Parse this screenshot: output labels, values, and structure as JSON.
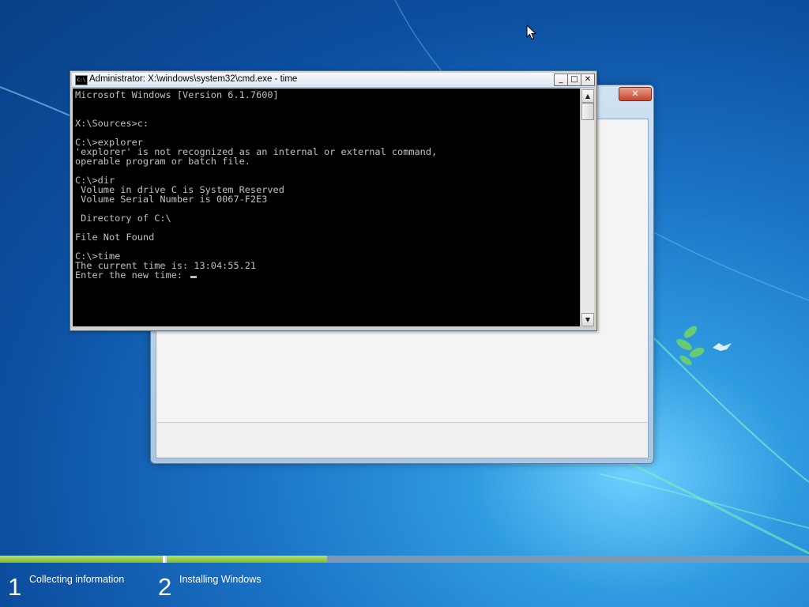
{
  "cmd": {
    "title": "Administrator: X:\\windows\\system32\\cmd.exe - time",
    "app_icon_text": "C:\\",
    "buttons": {
      "minimize": "_",
      "maximize": "□",
      "close": "✕"
    },
    "lines": [
      "Microsoft Windows [Version 6.1.7600]",
      "",
      "",
      "X:\\Sources>c:",
      "",
      "C:\\>explorer",
      "'explorer' is not recognized as an internal or external command,",
      "operable program or batch file.",
      "",
      "C:\\>dir",
      " Volume in drive C is System Reserved",
      " Volume Serial Number is 0067-F2E3",
      "",
      " Directory of C:\\",
      "",
      "File Not Found",
      "",
      "C:\\>time",
      "The current time is: 13:04:55.21",
      "Enter the new time: "
    ],
    "scroll_up": "▲",
    "scroll_down": "▼"
  },
  "setup_window": {
    "close_label": "✕"
  },
  "setup_progress": {
    "steps": [
      {
        "number": "1",
        "label": "Collecting information"
      },
      {
        "number": "2",
        "label": "Installing Windows"
      }
    ],
    "step1_progress": 1.0,
    "step2_progress": 0.25
  },
  "colors": {
    "console_bg": "#000000",
    "console_text": "#c0c0c0",
    "progress_green": "#7dbb2a",
    "desktop_blue": "#1b74c7"
  }
}
